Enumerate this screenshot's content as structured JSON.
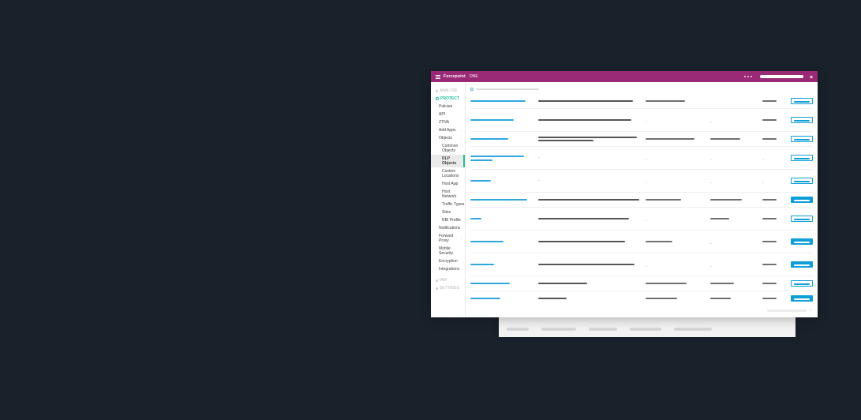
{
  "brand": {
    "strong": "Forcepoint",
    "light": "ONE"
  },
  "topnav": [
    {
      "label": "ANALYZE",
      "active": false
    },
    {
      "label": "PROTECT",
      "active": true
    }
  ],
  "bottomnav": [
    {
      "label": "IAM"
    },
    {
      "label": "SETTINGS"
    }
  ],
  "menu": [
    {
      "label": "Policies"
    },
    {
      "label": "API"
    },
    {
      "label": "ZTNA"
    },
    {
      "label": "Add Apps",
      "expand": true
    },
    {
      "label": "Objects",
      "expand": true,
      "children": [
        {
          "label": "Common Objects"
        },
        {
          "label": "DLP Objects",
          "active": true
        },
        {
          "label": "Custom Locations"
        },
        {
          "label": "Host App"
        },
        {
          "label": "Host Network"
        },
        {
          "label": "Traffic Types"
        },
        {
          "label": "Sites"
        },
        {
          "label": "RBI Profile"
        }
      ]
    },
    {
      "label": "Notifications",
      "expand": true
    },
    {
      "label": "Forward Proxy",
      "expand": true
    },
    {
      "label": "Mobile Security"
    },
    {
      "label": "Encryption"
    },
    {
      "label": "Integrations",
      "expand": true
    }
  ],
  "rows": [
    {
      "name_w": 70,
      "sub_w": 0,
      "desc1": 120,
      "desc2": 0,
      "c3_w": 50,
      "c4_w": 0,
      "c5_w": 18,
      "btn": "outline"
    },
    {
      "name_w": 55,
      "sub_w": 0,
      "desc1": 118,
      "desc2": 0,
      "c3": "-",
      "c4": "-",
      "c5_w": 18,
      "btn": "outline"
    },
    {
      "name_w": 48,
      "sub_w": 0,
      "desc1": 125,
      "desc2": 70,
      "c3_w": 62,
      "c4_w": 38,
      "c5_w": 18,
      "btn": "outline"
    },
    {
      "name_w": 68,
      "sub_w": 28,
      "desc1": 0,
      "desc2": 0,
      "c3": "-",
      "c3_only_dash": true,
      "c4": "-",
      "c4_only_dash": true,
      "c5_w_pre": "-",
      "c5_w": 0,
      "btn": "outline",
      "desc_dash": true
    },
    {
      "name_w": 26,
      "sub_w": 0,
      "desc1": 0,
      "desc2": 0,
      "c3": "-",
      "c4": "-",
      "c5_w": 0,
      "c5_dash": true,
      "btn": "outline",
      "desc_dash": true
    },
    {
      "name_w": 72,
      "sub_w": 0,
      "desc1": 128,
      "desc2": 0,
      "c3_w": 45,
      "c4_w": 40,
      "c5_w": 18,
      "btn": "filled"
    },
    {
      "name_w": 14,
      "sub_w": 0,
      "desc1": 115,
      "desc2": 0,
      "c3": "-",
      "c4_w": 24,
      "c5_w": 18,
      "btn": "outline"
    },
    {
      "name_w": 42,
      "sub_w": 0,
      "desc1": 110,
      "desc2": 0,
      "c3_w": 34,
      "c4": "-",
      "c5_w": 18,
      "btn": "filled"
    },
    {
      "name_w": 30,
      "sub_w": 0,
      "desc1": 122,
      "desc2": 0,
      "c3": "-",
      "c4": "-",
      "c5_w": 18,
      "btn": "filled"
    },
    {
      "name_w": 50,
      "sub_w": 0,
      "desc1": 62,
      "desc2": 0,
      "c3_w": 52,
      "c4_w": 30,
      "c5_w": 18,
      "btn": "outline"
    },
    {
      "name_w": 38,
      "sub_w": 0,
      "desc1": 36,
      "desc2": 0,
      "c3_w": 40,
      "c4_w": 26,
      "c5_w": 18,
      "btn": "filled"
    }
  ]
}
